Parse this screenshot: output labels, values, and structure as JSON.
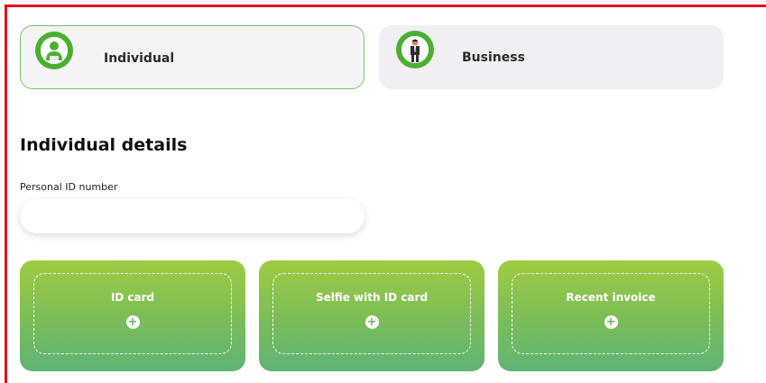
{
  "account_types": [
    {
      "label": "Individual",
      "icon": "individual-avatar-icon",
      "selected": true
    },
    {
      "label": "Business",
      "icon": "businessman-avatar-icon",
      "selected": false
    }
  ],
  "section_title": "Individual details",
  "personal_id": {
    "label": "Personal ID number",
    "value": "",
    "placeholder": ""
  },
  "uploads": [
    {
      "label": "ID card",
      "icon": "plus-icon"
    },
    {
      "label": "Selfie with ID card",
      "icon": "plus-icon"
    },
    {
      "label": "Recent invoice",
      "icon": "plus-icon"
    }
  ],
  "colors": {
    "accent_green": "#4caf32",
    "highlight_border": "#e0121b",
    "upload_gradient_top": "#9fcb43",
    "upload_gradient_bottom": "#5fb476"
  }
}
